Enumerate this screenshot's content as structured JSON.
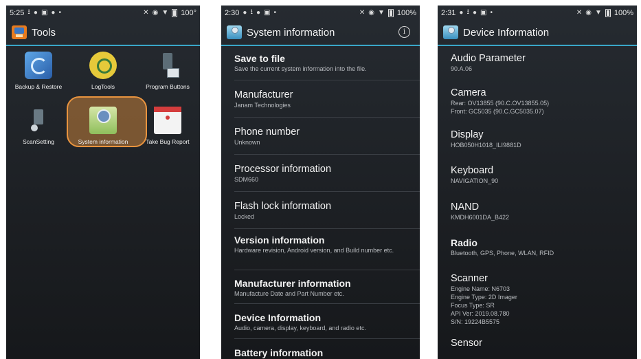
{
  "screens": [
    {
      "status": {
        "time": "5:25",
        "battery": "100°"
      },
      "appbar": {
        "title": "Tools"
      },
      "apps": [
        {
          "label": "Backup & Restore",
          "icon": "backup-icon"
        },
        {
          "label": "LogTools",
          "icon": "logtools-icon"
        },
        {
          "label": "Program Buttons",
          "icon": "program-buttons-icon"
        },
        {
          "label": "ScanSetting",
          "icon": "scan-setting-icon"
        },
        {
          "label": "System information",
          "icon": "system-information-icon"
        },
        {
          "label": "Take Bug Report",
          "icon": "bug-report-icon"
        }
      ],
      "highlight_color": "#e9943f"
    },
    {
      "status": {
        "time": "2:30",
        "battery": "100%"
      },
      "appbar": {
        "title": "System information",
        "info": "i"
      },
      "items": [
        {
          "title": "Save to file",
          "sub": "Save the current system information into the file."
        },
        {
          "title": "Manufacturer",
          "sub": "Janam Technologies"
        },
        {
          "title": "Phone number",
          "sub": "Unknown"
        },
        {
          "title": "Processor information",
          "sub": "SDM660"
        },
        {
          "title": "Flash lock information",
          "sub": "Locked"
        },
        {
          "title": "Version information",
          "sub": "Hardware revision, Android version, and Build number etc."
        },
        {
          "title": "Manufacturer information",
          "sub": "Manufacture Date and Part Number etc."
        },
        {
          "title": "Device Information",
          "sub": "Audio, camera, display, keyboard, and radio etc."
        },
        {
          "title": "Battery information",
          "sub": ""
        }
      ]
    },
    {
      "status": {
        "time": "2:31",
        "battery": "100%"
      },
      "appbar": {
        "title": "Device Information"
      },
      "items": [
        {
          "title": "Audio Parameter",
          "sub": [
            "90.A.06"
          ]
        },
        {
          "title": "Camera",
          "sub": [
            "Rear: OV13855 (90.C.OV13855.05)",
            "Front: GC5035 (90.C.GC5035.07)"
          ]
        },
        {
          "title": "Display",
          "sub": [
            "HOB050H1018_ILI9881D"
          ]
        },
        {
          "title": "Keyboard",
          "sub": [
            "NAVIGATION_90"
          ]
        },
        {
          "title": "NAND",
          "sub": [
            "KMDH6001DA_B422"
          ]
        },
        {
          "title": "Radio",
          "sub": [
            "Bluetooth, GPS, Phone, WLAN, RFID"
          ]
        },
        {
          "title": "Scanner",
          "sub": [
            "Engine Name: N6703",
            "Engine Type: 2D Imager",
            "Focus Type: SR",
            "API Ver: 2019.08.780",
            "S/N: 19224B5575"
          ]
        },
        {
          "title": "Sensor",
          "sub": []
        }
      ]
    }
  ],
  "accent_color": "#3aa7c9"
}
